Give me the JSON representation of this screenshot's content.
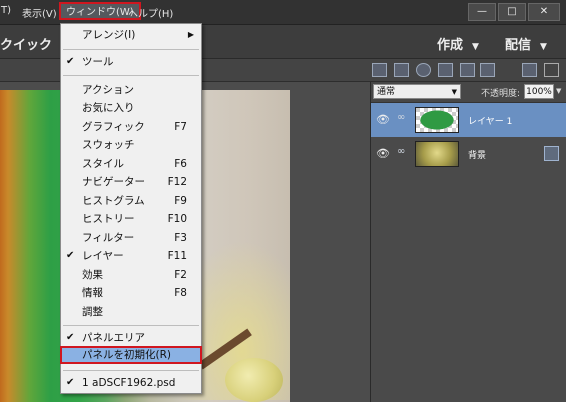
{
  "menubar": {
    "items": [
      {
        "label": "T)"
      },
      {
        "label": "表示(V)"
      },
      {
        "label": "ウィンドウ(W)"
      },
      {
        "label": "ヘルプ(H)"
      }
    ],
    "window_controls": [
      "—",
      "□",
      "✕"
    ]
  },
  "modebar": {
    "mode_label": "クイック",
    "create_label": "作成",
    "share_label": "配信",
    "arrow": "▼"
  },
  "layers_panel": {
    "blend_mode": "通常",
    "opacity_label": "不透明度:",
    "opacity_value": "100%",
    "layers": [
      {
        "name": "レイヤー 1",
        "selected": true
      },
      {
        "name": "背景",
        "selected": false
      }
    ]
  },
  "window_menu": {
    "items": [
      {
        "label": "アレンジ(I)",
        "shortcut": "",
        "checked": false,
        "submenu": true
      },
      {
        "label": "ツール",
        "shortcut": "",
        "checked": true
      },
      {
        "label": "アクション",
        "shortcut": "",
        "checked": false
      },
      {
        "label": "お気に入り",
        "shortcut": "",
        "checked": false
      },
      {
        "label": "グラフィック",
        "shortcut": "F7",
        "checked": false
      },
      {
        "label": "スウォッチ",
        "shortcut": "",
        "checked": false
      },
      {
        "label": "スタイル",
        "shortcut": "F6",
        "checked": false
      },
      {
        "label": "ナビゲーター",
        "shortcut": "F12",
        "checked": false
      },
      {
        "label": "ヒストグラム",
        "shortcut": "F9",
        "checked": false
      },
      {
        "label": "ヒストリー",
        "shortcut": "F10",
        "checked": false
      },
      {
        "label": "フィルター",
        "shortcut": "F3",
        "checked": false
      },
      {
        "label": "レイヤー",
        "shortcut": "F11",
        "checked": true
      },
      {
        "label": "効果",
        "shortcut": "F2",
        "checked": false
      },
      {
        "label": "情報",
        "shortcut": "F8",
        "checked": false
      },
      {
        "label": "調整",
        "shortcut": "",
        "checked": false
      },
      {
        "label": "パネルエリア",
        "shortcut": "",
        "checked": true
      },
      {
        "label": "パネルを初期化(R)",
        "shortcut": "",
        "checked": false,
        "highlighted": true
      },
      {
        "label": "1 aDSCF1962.psd",
        "shortcut": "",
        "checked": true
      }
    ],
    "check_glyph": "✔",
    "submenu_glyph": "▶"
  },
  "colors": {
    "highlight_border": "#d0161f",
    "menu_highlight": "#8ab1e3",
    "selected_layer": "#6a90c2"
  }
}
